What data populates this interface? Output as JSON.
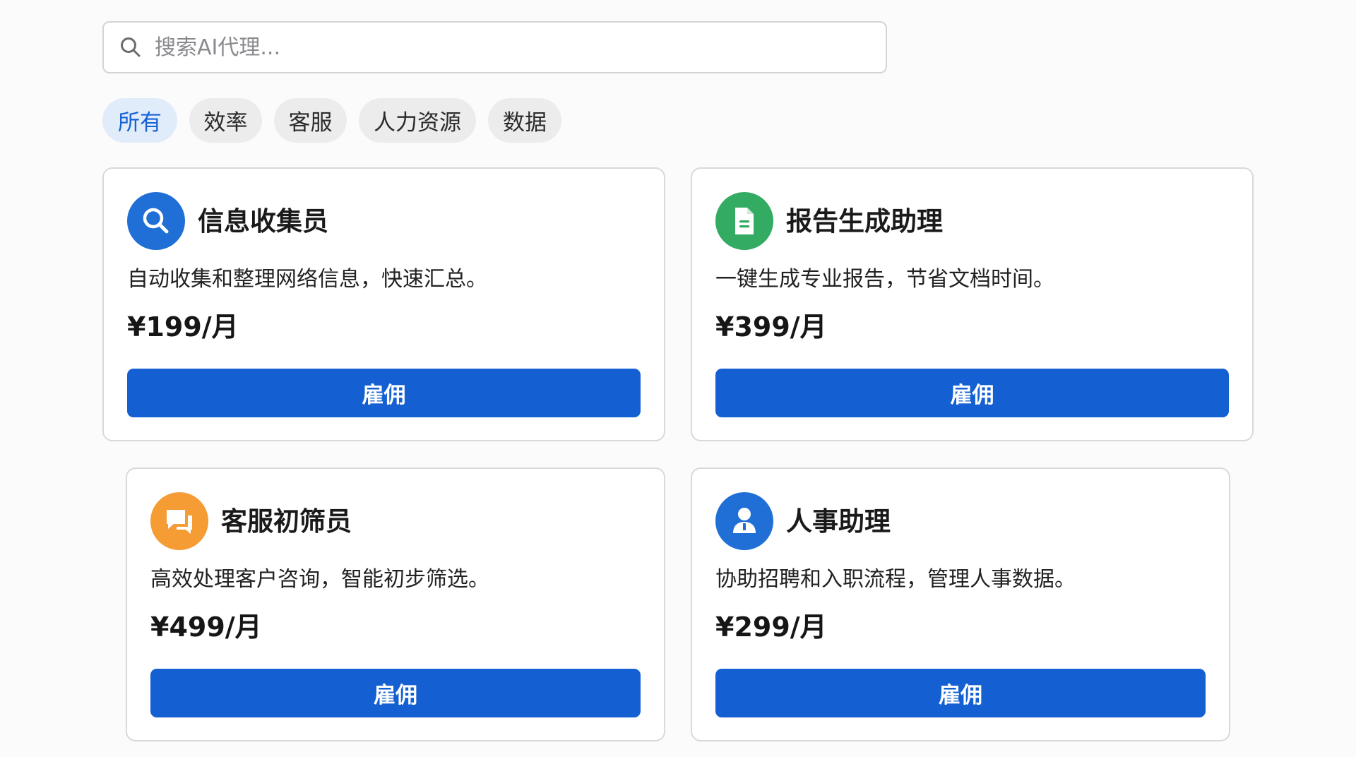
{
  "search": {
    "placeholder": "搜索AI代理...",
    "value": ""
  },
  "filters": {
    "items": [
      {
        "label": "所有",
        "active": true
      },
      {
        "label": "效率",
        "active": false
      },
      {
        "label": "客服",
        "active": false
      },
      {
        "label": "人力资源",
        "active": false
      },
      {
        "label": "数据",
        "active": false
      }
    ]
  },
  "colors": {
    "primary": "#1460d2",
    "chip_active_bg": "#e1ecfa",
    "chip_active_text": "#1561d6",
    "chip_bg": "#ececec"
  },
  "agents": [
    {
      "icon": "search-icon",
      "icon_bg": "#1f6fd6",
      "title": "信息收集员",
      "description": "自动收集和整理网络信息，快速汇总。",
      "price": "¥199/月",
      "button_label": "雇佣"
    },
    {
      "icon": "document-icon",
      "icon_bg": "#33ab63",
      "title": "报告生成助理",
      "description": "一键生成专业报告，节省文档时间。",
      "price": "¥399/月",
      "button_label": "雇佣"
    },
    {
      "icon": "chat-icon",
      "icon_bg": "#f59c34",
      "title": "客服初筛员",
      "description": "高效处理客户咨询，智能初步筛选。",
      "price": "¥499/月",
      "button_label": "雇佣"
    },
    {
      "icon": "user-icon",
      "icon_bg": "#1f6fd6",
      "title": "人事助理",
      "description": "协助招聘和入职流程，管理人事数据。",
      "price": "¥299/月",
      "button_label": "雇佣"
    }
  ]
}
